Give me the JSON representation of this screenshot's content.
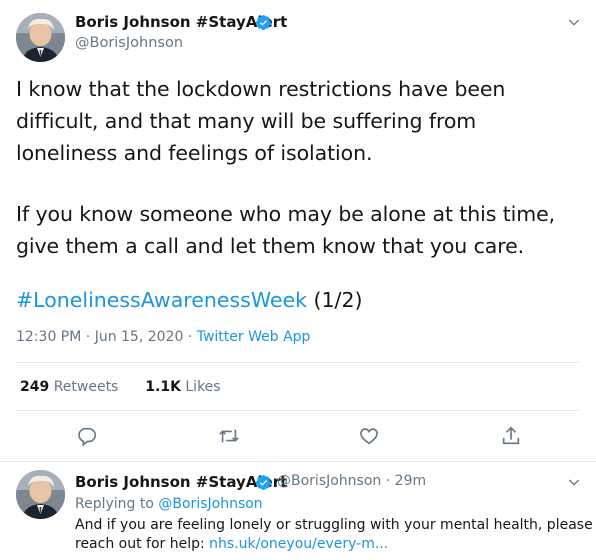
{
  "tweet": {
    "author_name": "Boris Johnson #StayAlert",
    "author_handle": "@BorisJohnson",
    "paragraph1": "I know that the lockdown restrictions have been difficult, and that many will be suffering from loneliness and feelings of isolation.",
    "paragraph2": "If you know someone who may be alone at this time, give them a call and let them know that you care.",
    "hashtag": "#LonelinessAwarenessWeek",
    "thread_marker": "(1/2)",
    "time": "12:30 PM",
    "date": "Jun 15, 2020",
    "source": "Twitter Web App",
    "retweets_count": "249",
    "retweets_label": "Retweets",
    "likes_count": "1.1K",
    "likes_label": "Likes"
  },
  "reply": {
    "author_name": "Boris Johnson #StayAlert",
    "author_handle": "@BorisJohnson",
    "time_ago": "29m",
    "replying_to_label": "Replying to",
    "replying_to_handle": "@BorisJohnson",
    "text_line1": "And if you are feeling lonely or struggling with your mental health, please",
    "text_prefix": "reach out for help:",
    "link": "nhs.uk/oneyou/every-m..."
  },
  "icons": {
    "verified": "verified-badge-icon",
    "more": "chevron-down-icon",
    "reply": "reply-icon",
    "retweet": "retweet-icon",
    "like": "heart-icon",
    "share": "share-icon"
  },
  "colors": {
    "accent": "#1DA1F2",
    "link": "#1B95E0",
    "secondary_text": "#657786",
    "divider": "#E6ECF0"
  }
}
